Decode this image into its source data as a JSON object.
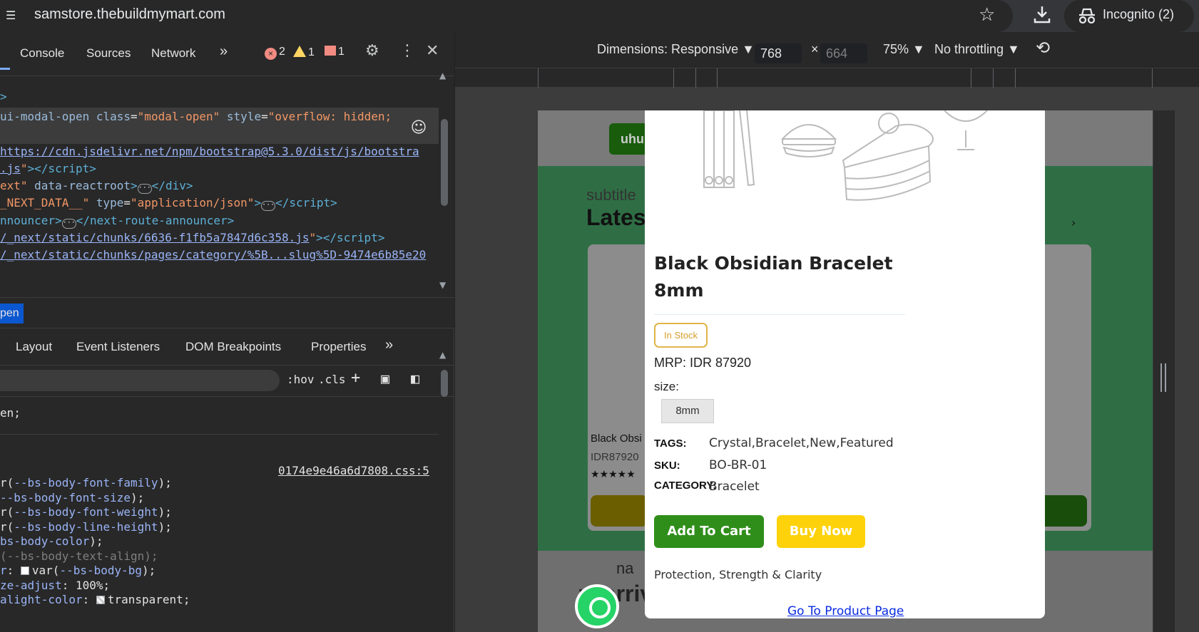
{
  "browser": {
    "url": "samstore.thebuildmymart.com",
    "incognito_label": "Incognito (2)"
  },
  "devtools": {
    "tabs": [
      "Console",
      "Sources",
      "Network"
    ],
    "more_tabs": "»",
    "errors": "2",
    "warnings": "1",
    "issues": "1",
    "dom_lines": [
      {
        "html": "<span class='tagc'>&gt;</span>"
      },
      {
        "html": "<span class='attr'>ui-modal-open class</span>=<span class='val'>\"modal-open\"</span> <span class='attr'>style</span>=<span class='val'>\"overflow: hidden;</span>"
      },
      {
        "html": ""
      },
      {
        "html": "<span class='link'>https://cdn.jsdelivr.net/npm/bootstrap@5.3.0/dist/js/bootstra</span>"
      },
      {
        "html": "<span class='link'>.js</span><span class='val'>\"</span><span class='tagc'>&gt;&lt;/script&gt;</span>"
      },
      {
        "html": "<span class='val'>ext\"</span> <span class='attr'>data-reactroot</span><span class='tagc'>&gt;</span><span class='ellip'>···</span><span class='tagc'>&lt;/div&gt;</span>"
      },
      {
        "html": "<span class='val'>_NEXT_DATA__\"</span> <span class='attr'>type</span>=<span class='val'>\"application/json\"</span><span class='tagc'>&gt;</span><span class='ellip'>···</span><span class='tagc'>&lt;/script&gt;</span>"
      },
      {
        "html": "<span class='tagc'>nnouncer&gt;</span><span class='ellip'>···</span><span class='tagc'>&lt;/next-route-announcer&gt;</span>"
      },
      {
        "html": "<span class='link'>/_next/static/chunks/6636-f1fb5a7847d6c358.js</span><span class='val'>\"</span><span class='tagc'>&gt;&lt;/script&gt;</span>"
      },
      {
        "html": "<span class='link'>/_next/static/chunks/pages/category/%5B...slug%5D-9474e6b85e20</span>"
      }
    ],
    "breadcrumb": "pen",
    "sub_tabs": [
      "Layout",
      "Event Listeners",
      "DOM Breakpoints",
      "Properties"
    ],
    "filter_buttons": [
      ":hov",
      ".cls",
      "+"
    ],
    "css_source": "0174e9e46a6d7808.css:5",
    "css_top_line": "en;",
    "css_lines": [
      {
        "html": "r(<span class='css-prop'>--bs-body-font-family</span>);"
      },
      {
        "html": "<span class='css-prop'>--bs-body-font-size</span>);"
      },
      {
        "html": "r(<span class='css-prop'>--bs-body-font-weight</span>);"
      },
      {
        "html": "r(<span class='css-prop'>--bs-body-line-height</span>);"
      },
      {
        "html": "<span class='css-prop'>bs-body-color</span>);"
      },
      {
        "html": "<span class='css-dim'>(--bs-body-text-align);</span>"
      },
      {
        "html": "<span class='css-prop'>r</span>: <span class='swatch'></span>var(<span class='css-prop'>--bs-body-bg</span>);"
      },
      {
        "html": "<span class='css-prop'>ze-adjust</span>: 100%;"
      },
      {
        "html": "<span class='css-prop'>alight-color</span>: <span class='swatch trans'></span>transparent;"
      }
    ]
  },
  "device_toolbar": {
    "dimensions_label": "Dimensions: Responsive ▼",
    "width": "768",
    "times": "×",
    "height": "664",
    "zoom": "75% ▼",
    "throttling": "No throttling ▼"
  },
  "background_page": {
    "button_text": "uhu",
    "subtitle": "subtitle",
    "title": "Lates",
    "card_name": "Black Obsi",
    "card_price": "IDR87920",
    "card_stars": "★★★★★",
    "chevron": "›",
    "section2_subtitle": "na",
    "section2_title": "w arrivals"
  },
  "modal": {
    "title": "Black Obsidian Bracelet 8mm",
    "stock": "In Stock",
    "mrp_label": "MRP:",
    "mrp_value": "IDR 87920",
    "size_label": "size:",
    "size_value": "8mm",
    "tags_label": "TAGS:",
    "tags_value": "Crystal,Bracelet,New,Featured",
    "sku_label": "SKU:",
    "sku_value": "BO-BR-01",
    "category_label": "CATEGORY:",
    "category_value": "Bracelet",
    "add_to_cart": "Add To Cart",
    "buy_now": "Buy Now",
    "description": "Protection, Strength & Clarity",
    "product_link": "Go To Product Page"
  }
}
